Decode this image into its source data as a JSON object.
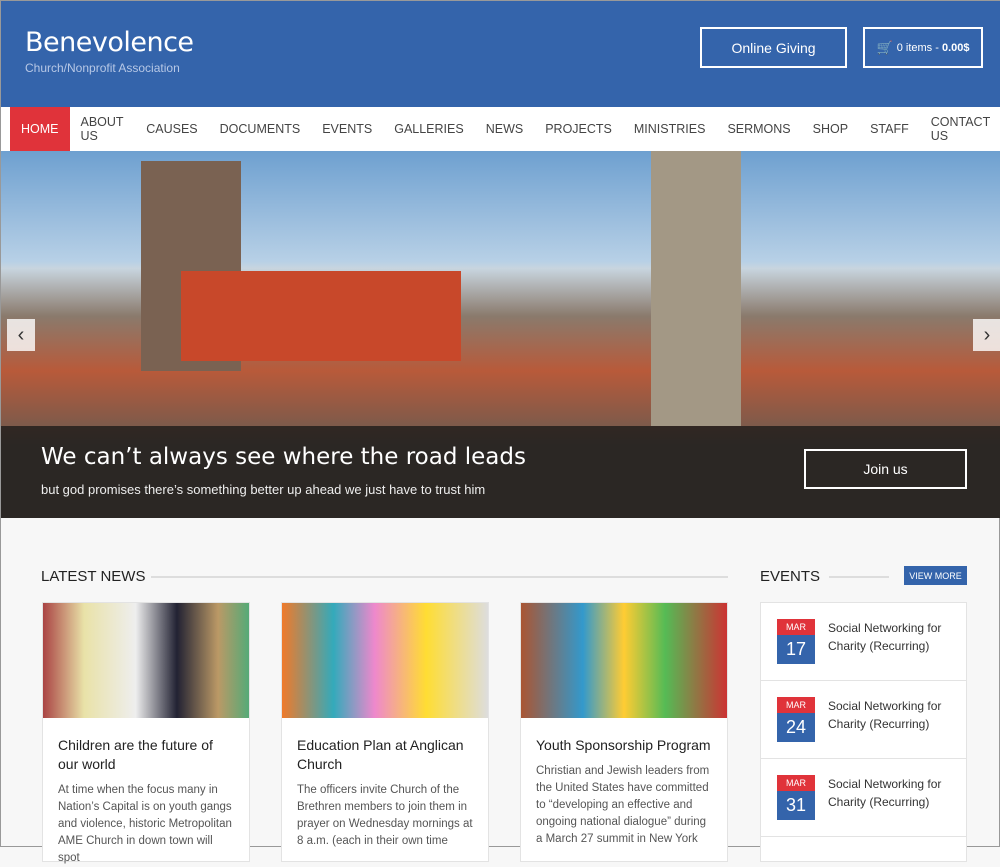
{
  "header": {
    "title": "Benevolence",
    "tagline": "Church/Nonprofit Association",
    "giving": "Online Giving",
    "cart_items": "0 items -",
    "cart_total": "0.00$"
  },
  "nav": [
    "HOME",
    "ABOUT US",
    "CAUSES",
    "DOCUMENTS",
    "EVENTS",
    "GALLERIES",
    "NEWS",
    "PROJECTS",
    "MINISTRIES",
    "SERMONS",
    "SHOP",
    "STAFF",
    "CONTACT US"
  ],
  "hero": {
    "title": "We can’t always see where the road leads",
    "subtitle": "but god promises there’s something better up ahead we just have to trust him",
    "button": "Join us"
  },
  "news": {
    "title": "LATEST NEWS",
    "items": [
      {
        "title": "Children are the future of our world",
        "text": "At time when the focus many in Nation’s Capital is on youth gangs and violence, historic Metropolitan AME Church in down town will spot"
      },
      {
        "title": "Education Plan at Anglican Church",
        "text": "The officers invite Church of the Brethren members to join them in prayer on Wednesday mornings at 8 a.m. (each in their own time"
      },
      {
        "title": "Youth Sponsorship Program",
        "text": "Christian and Jewish leaders from the United States have committed to “developing an effective and ongoing national dialogue” during a March 27 summit in New York"
      }
    ]
  },
  "events": {
    "title": "EVENTS",
    "view_more": "VIEW MORE",
    "items": [
      {
        "month": "MAR",
        "day": "17",
        "title": "Social Networking for Charity (Recurring)"
      },
      {
        "month": "MAR",
        "day": "24",
        "title": "Social Networking for Charity (Recurring)"
      },
      {
        "month": "MAR",
        "day": "31",
        "title": "Social Networking for Charity (Recurring)"
      }
    ]
  },
  "colors": {
    "brand": "#3464ab",
    "accent": "#e0333a"
  }
}
